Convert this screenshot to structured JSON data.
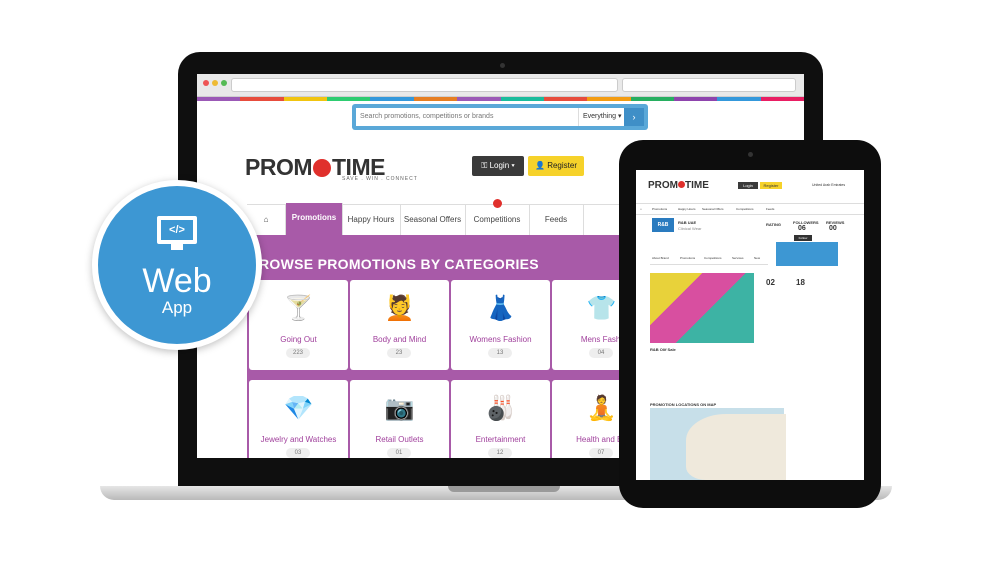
{
  "browser": {
    "stripe_colors": [
      "#9b59b6",
      "#e74c3c",
      "#f1c40f",
      "#2ecc71",
      "#3498db",
      "#e67e22",
      "#9b59b6",
      "#1abc9c",
      "#e74c3c",
      "#f39c12",
      "#27ae60",
      "#8e44ad",
      "#3498db",
      "#e91e63"
    ]
  },
  "site": {
    "search_placeholder": "Search promotions, competitions or brands",
    "search_scope": "Everything",
    "logo_text_left": "PROM",
    "logo_text_right": "TIME",
    "tagline": "SAVE . WIN . CONNECT",
    "login_label": "Login",
    "register_label": "Register",
    "nav": [
      "Promotions",
      "Happy Hours",
      "Seasonal Offers",
      "Competitions",
      "Feeds"
    ],
    "active_nav": "Promotions",
    "browse_heading": "ROWSE PROMOTIONS BY CATEGORIES",
    "categories": [
      {
        "label": "Going Out",
        "count": "223",
        "icon": "cocktail-icon",
        "glyph": "🍸"
      },
      {
        "label": "Body and Mind",
        "count": "23",
        "icon": "massage-icon",
        "glyph": "💆"
      },
      {
        "label": "Womens Fashion",
        "count": "13",
        "icon": "dress-icon",
        "glyph": "👗"
      },
      {
        "label": "Mens Fashi",
        "count": "04",
        "icon": "shirt-icon",
        "glyph": "👕"
      },
      {
        "label": "Jewelry and Watches",
        "count": "03",
        "icon": "diamond-icon",
        "glyph": "💎"
      },
      {
        "label": "Retail Outlets",
        "count": "01",
        "icon": "camera-icon",
        "glyph": "📷"
      },
      {
        "label": "Entertainment",
        "count": "12",
        "icon": "bowling-icon",
        "glyph": "🎳"
      },
      {
        "label": "Health and Be",
        "count": "07",
        "icon": "yoga-icon",
        "glyph": "🧘"
      }
    ]
  },
  "badge": {
    "line1": "Web",
    "line2": "App",
    "code_glyph": "</>"
  },
  "tablet": {
    "logo_left": "PROM",
    "logo_right": "TIME",
    "login": "Login",
    "register": "Register",
    "country": "United Arab Emirates",
    "nav": [
      "Promotions",
      "Happy Hours",
      "Seasonal Offers",
      "Competitions",
      "Feeds"
    ],
    "brand": "R&B",
    "brand_name": "R&B UAE",
    "brand_type": "Clinical Wear",
    "rating_label": "RATING",
    "followers_label": "FOLLOWERS",
    "followers": "06",
    "reviews_label": "REVIEWS",
    "reviews": "00",
    "follow": "Follow",
    "tabs": [
      "About Brand",
      "Promotions",
      "Competitions",
      "Services",
      "New"
    ],
    "promo_title": "R&B Olif Sale",
    "date_from": "02",
    "date_to": "18",
    "locations_heading": "PROMOTION LOCATIONS ON MAP"
  }
}
